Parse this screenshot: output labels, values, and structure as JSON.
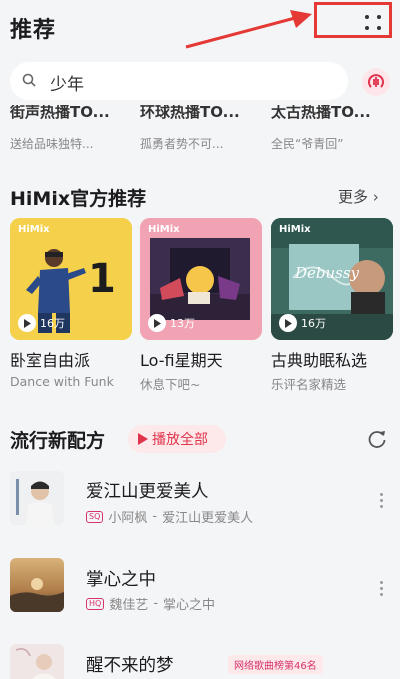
{
  "header": {
    "title": "推荐"
  },
  "search": {
    "query": "少年"
  },
  "partial_row": [
    {
      "title": "街声热播TO...",
      "subtitle": "送给品味独特..."
    },
    {
      "title": "环球热播TO...",
      "subtitle": "孤勇者势不可..."
    },
    {
      "title": "太古热播TO...",
      "subtitle": "全民“爷青回”"
    }
  ],
  "himix": {
    "section_title": "HiMix官方推荐",
    "more_label": "更多",
    "cards": [
      {
        "logo": "HiMix",
        "plays": "16万",
        "title": "卧室自由派",
        "subtitle": "Dance with Funk"
      },
      {
        "logo": "HiMix",
        "plays": "13万",
        "title": "Lo-fi星期天",
        "subtitle": "休息下吧~"
      },
      {
        "logo": "HiMix",
        "plays": "16万",
        "title": "古典助眠私选",
        "subtitle": "乐评名家精选"
      }
    ],
    "cover1_digit": "1",
    "cover3_word": "Debussy"
  },
  "new_pop": {
    "section_title": "流行新配方",
    "play_all_label": "播放全部",
    "songs": [
      {
        "title": "爱江山更爱美人",
        "quality": "SQ",
        "artist": "小阿枫",
        "album": "爱江山更爱美人"
      },
      {
        "title": "掌心之中",
        "quality": "HQ",
        "artist": "魏佳艺",
        "album": "掌心之中"
      },
      {
        "title": "醒不来的梦",
        "chart_badge": "网络歌曲榜第46名"
      }
    ]
  },
  "colors": {
    "accent": "#e0344c",
    "annotation_red": "#e53935"
  }
}
